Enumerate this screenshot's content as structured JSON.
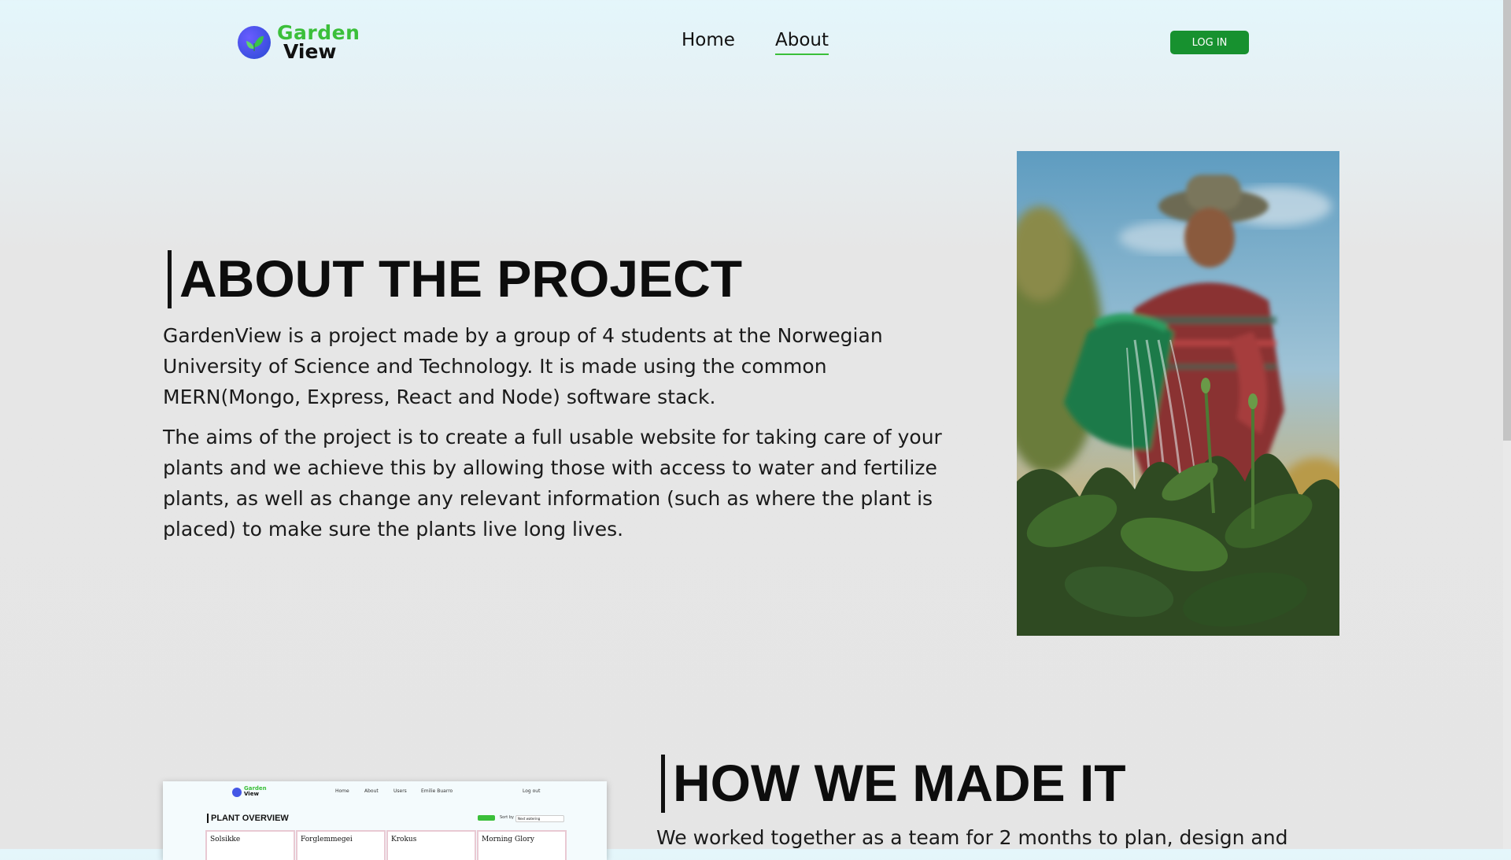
{
  "header": {
    "logo_line1": "Garden",
    "logo_line2": "View",
    "nav": {
      "home": "Home",
      "about": "About"
    },
    "login_label": "LOG IN"
  },
  "about": {
    "title": "ABOUT THE PROJECT",
    "paragraph1": "GardenView is a project made by a group of 4 students at the Norwegian University of Science and Technology. It is made using the common MERN(Mongo, Express, React and Node) software stack.",
    "paragraph2": "The aims of the project is to create a full usable website for taking care of your plants and we achieve this by allowing those with access to water and fertilize plants, as well as change any relevant information (such as where the plant is placed) to make sure the plants live long lives."
  },
  "how": {
    "title": "HOW WE MADE IT",
    "text": "We worked together as a team for 2 months to plan, design and"
  },
  "screenshot": {
    "logo_line1": "Garden",
    "logo_line2": "View",
    "nav": [
      "Home",
      "About",
      "Users",
      "Emilie Buarro"
    ],
    "logout": "Log out",
    "title": "PLANT OVERVIEW",
    "sort_label": "Sort by",
    "sort_value": "Next watering",
    "cards": [
      "Solsikke",
      "Forglemmegei",
      "Krokus",
      "Morning Glory"
    ]
  },
  "colors": {
    "brand_green": "#3bbf3a",
    "button_green": "#17912f",
    "logo_blue": "#4457e6"
  },
  "icons": {
    "logo": "leaf-icon"
  }
}
